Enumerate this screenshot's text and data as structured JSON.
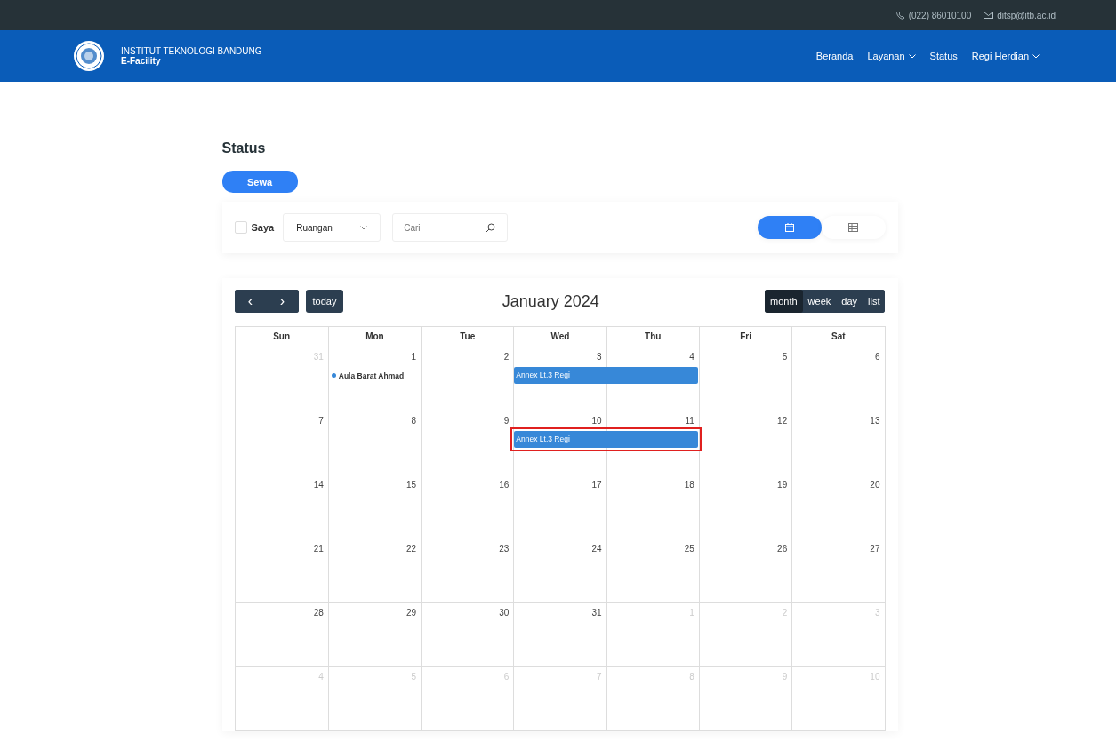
{
  "topbar": {
    "phone": "(022) 86010100",
    "email": "ditsp@itb.ac.id"
  },
  "header": {
    "institution": "INSTITUT TEKNOLOGI BANDUNG",
    "app_name": "E-Facility",
    "nav": [
      {
        "label": "Beranda",
        "dropdown": false
      },
      {
        "label": "Layanan",
        "dropdown": true
      },
      {
        "label": "Status",
        "dropdown": false
      },
      {
        "label": "Regi Herdian",
        "dropdown": true
      }
    ]
  },
  "page_title": "Status",
  "primary_button": "Sewa",
  "filters": {
    "mine_checkbox": {
      "label": "Saya",
      "checked": false
    },
    "category_select": {
      "value": "Ruangan"
    },
    "search": {
      "placeholder": "Cari"
    },
    "view_toggle": [
      {
        "kind": "calendar",
        "selected": true
      },
      {
        "kind": "table",
        "selected": false
      }
    ]
  },
  "calendar": {
    "title": "January 2024",
    "prev": "‹",
    "next": "›",
    "today_button": "today",
    "views": [
      {
        "label": "month",
        "selected": true
      },
      {
        "label": "week",
        "selected": false
      },
      {
        "label": "day",
        "selected": false
      },
      {
        "label": "list",
        "selected": false
      }
    ],
    "weekdays": [
      "Sun",
      "Mon",
      "Tue",
      "Wed",
      "Thu",
      "Fri",
      "Sat"
    ],
    "weeks": [
      {
        "days": [
          {
            "label": "31",
            "other_month": true
          },
          {
            "label": "1",
            "other_month": false,
            "events": [
              {
                "kind": "dot",
                "title": "Aula Barat Ahmad",
                "spans_next_day": false,
                "highlighted": false
              }
            ]
          },
          {
            "label": "2",
            "other_month": false
          },
          {
            "label": "3",
            "other_month": false,
            "events": [
              {
                "kind": "bar",
                "title": "Annex Lt.3 Regi",
                "spans_next_day": true,
                "highlighted": false
              }
            ]
          },
          {
            "label": "4",
            "other_month": false
          },
          {
            "label": "5",
            "other_month": false
          },
          {
            "label": "6",
            "other_month": false
          }
        ]
      },
      {
        "days": [
          {
            "label": "7",
            "other_month": false
          },
          {
            "label": "8",
            "other_month": false
          },
          {
            "label": "9",
            "other_month": false
          },
          {
            "label": "10",
            "other_month": false,
            "events": [
              {
                "kind": "bar",
                "title": "Annex Lt.3 Regi",
                "spans_next_day": true,
                "highlighted": true
              }
            ]
          },
          {
            "label": "11",
            "other_month": false
          },
          {
            "label": "12",
            "other_month": false
          },
          {
            "label": "13",
            "other_month": false
          }
        ]
      },
      {
        "days": [
          {
            "label": "14",
            "other_month": false
          },
          {
            "label": "15",
            "other_month": false
          },
          {
            "label": "16",
            "other_month": false
          },
          {
            "label": "17",
            "other_month": false
          },
          {
            "label": "18",
            "other_month": false
          },
          {
            "label": "19",
            "other_month": false
          },
          {
            "label": "20",
            "other_month": false
          }
        ]
      },
      {
        "days": [
          {
            "label": "21",
            "other_month": false
          },
          {
            "label": "22",
            "other_month": false
          },
          {
            "label": "23",
            "other_month": false
          },
          {
            "label": "24",
            "other_month": false
          },
          {
            "label": "25",
            "other_month": false
          },
          {
            "label": "26",
            "other_month": false
          },
          {
            "label": "27",
            "other_month": false
          }
        ]
      },
      {
        "days": [
          {
            "label": "28",
            "other_month": false
          },
          {
            "label": "29",
            "other_month": false
          },
          {
            "label": "30",
            "other_month": false
          },
          {
            "label": "31",
            "other_month": false
          },
          {
            "label": "1",
            "other_month": true
          },
          {
            "label": "2",
            "other_month": true
          },
          {
            "label": "3",
            "other_month": true
          }
        ]
      },
      {
        "days": [
          {
            "label": "4",
            "other_month": true
          },
          {
            "label": "5",
            "other_month": true
          },
          {
            "label": "6",
            "other_month": true
          },
          {
            "label": "7",
            "other_month": true
          },
          {
            "label": "8",
            "other_month": true
          },
          {
            "label": "9",
            "other_month": true
          },
          {
            "label": "10",
            "other_month": true
          }
        ]
      }
    ]
  }
}
